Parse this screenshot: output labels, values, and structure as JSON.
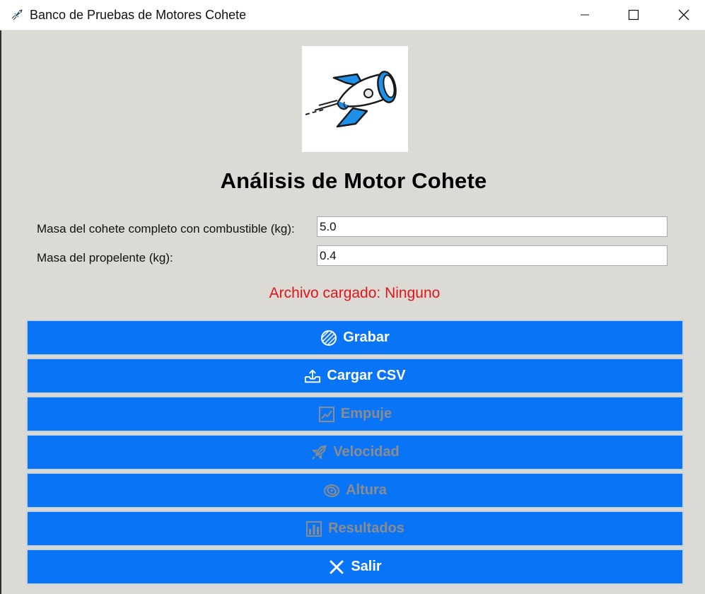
{
  "window": {
    "title": "Banco de Pruebas de Motores Cohete",
    "app_icon": "rocket-icon",
    "controls": [
      "minimize-icon",
      "maximize-icon",
      "close-icon"
    ]
  },
  "logo": {
    "icon": "rocket-icon"
  },
  "heading": "Análisis de Motor Cohete",
  "form": {
    "mass_label": "Masa del cohete completo con combustible (kg):",
    "mass_value": "5.0",
    "propellant_label": "Masa del propelente (kg):",
    "propellant_value": "0.4"
  },
  "status": {
    "text": "Archivo cargado: Ninguno",
    "color": "#e2141a"
  },
  "buttons": [
    {
      "label": "Grabar",
      "icon": "record-icon",
      "enabled": true
    },
    {
      "label": "Cargar CSV",
      "icon": "upload-icon",
      "enabled": true
    },
    {
      "label": "Empuje",
      "icon": "line-chart-icon",
      "enabled": false
    },
    {
      "label": "Velocidad",
      "icon": "rocket-icon",
      "enabled": false
    },
    {
      "label": "Altura",
      "icon": "orbit-icon",
      "enabled": false
    },
    {
      "label": "Resultados",
      "icon": "bar-chart-icon",
      "enabled": false
    },
    {
      "label": "Salir",
      "icon": "close-icon",
      "enabled": true
    }
  ],
  "colors": {
    "button_bg": "#0a74f7",
    "button_text_enabled": "#ffffff",
    "button_text_disabled": "#8c8c8c",
    "window_bg": "#dcdad5"
  }
}
